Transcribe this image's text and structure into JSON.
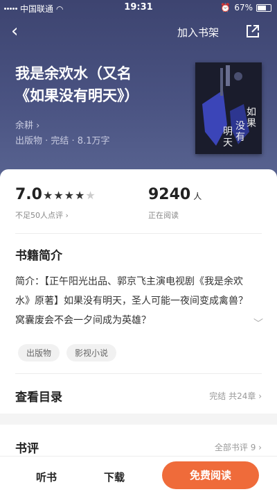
{
  "status_bar": {
    "carrier": "中国联通",
    "time": "19:31",
    "battery": "67%"
  },
  "nav": {
    "add_to_shelf": "加入书架"
  },
  "book": {
    "title_line1": "我是余欢水（又名",
    "title_line2": "《如果没有明天》）",
    "author": "余耕 ›",
    "meta": "出版物 · 完结 · 8.1万字",
    "cover_text": [
      "如",
      "果",
      "没有",
      "明天"
    ]
  },
  "stats": {
    "rating": "7.0",
    "rating_stars": 3.5,
    "rating_note": "不足50人点评 ›",
    "readers": "9240",
    "readers_unit": "人",
    "readers_note": "正在阅读"
  },
  "intro": {
    "heading": "书籍简介",
    "text": "简介：【正午阳光出品、郭京飞主演电视剧《我是余欢水》原著】如果没有明天，圣人可能一夜间变成禽兽？窝囊废会不会一夕间成为英雄？",
    "tags": [
      "出版物",
      "影视小说"
    ]
  },
  "catalog": {
    "heading": "查看目录",
    "info": "完结 共24章 ›"
  },
  "reviews": {
    "heading": "书评",
    "info": "全部书评 9 ›"
  },
  "bottom": {
    "listen": "听书",
    "download": "下载",
    "read_free": "免费阅读"
  },
  "colors": {
    "header_bg": "#4a5382",
    "accent": "#ef6b3a"
  }
}
